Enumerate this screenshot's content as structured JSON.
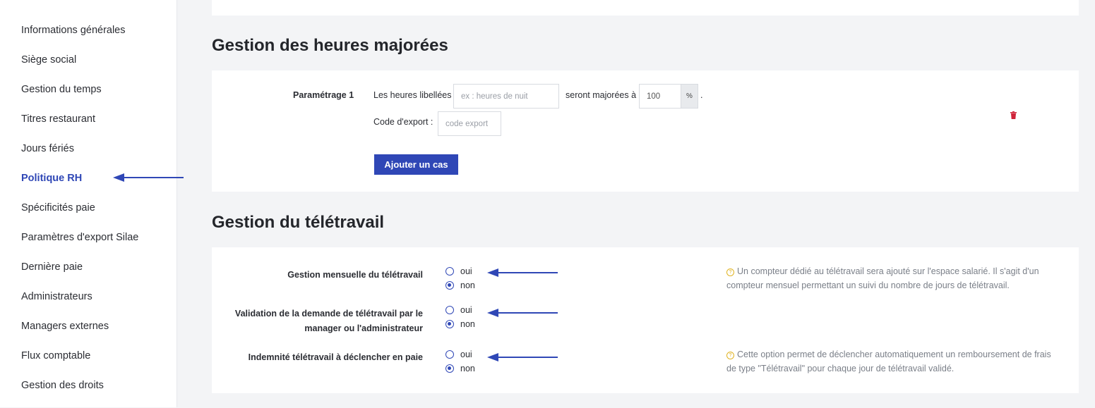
{
  "sidebar": {
    "items": [
      {
        "label": "Informations générales"
      },
      {
        "label": "Siège social"
      },
      {
        "label": "Gestion du temps"
      },
      {
        "label": "Titres restaurant"
      },
      {
        "label": "Jours fériés"
      },
      {
        "label": "Politique RH",
        "active": true
      },
      {
        "label": "Spécificités paie"
      },
      {
        "label": "Paramètres d'export Silae"
      },
      {
        "label": "Dernière paie"
      },
      {
        "label": "Administrateurs"
      },
      {
        "label": "Managers externes"
      },
      {
        "label": "Flux comptable"
      },
      {
        "label": "Gestion des droits"
      }
    ]
  },
  "heures_majorees": {
    "title": "Gestion des heures majorées",
    "setting_label": "Paramétrage 1",
    "text_before": "Les heures libellées",
    "name_placeholder": "ex : heures de nuit",
    "text_middle": "seront majorées à",
    "rate_value": "100",
    "rate_unit": "%",
    "text_end": ".",
    "export_label": "Code d'export :",
    "export_placeholder": "code export",
    "add_button": "Ajouter un cas"
  },
  "teletravail": {
    "title": "Gestion du télétravail",
    "rows": [
      {
        "label": "Gestion mensuelle du télétravail",
        "oui": "oui",
        "non": "non",
        "selected": "non",
        "help": "Un compteur dédié au télétravail sera ajouté sur l'espace salarié. Il s'agit d'un compteur mensuel permettant un suivi du nombre de jours de télétravail."
      },
      {
        "label": "Validation de la demande de télétravail par le manager ou l'administrateur",
        "oui": "oui",
        "non": "non",
        "selected": "non"
      },
      {
        "label": "Indemnité télétravail à déclencher en paie",
        "oui": "oui",
        "non": "non",
        "selected": "non",
        "help": "Cette option permet de déclencher automatiquement un remboursement de frais de type \"Télétravail\" pour chaque jour de télétravail validé."
      }
    ]
  },
  "colors": {
    "accent": "#2f47b6",
    "danger": "#d0243a",
    "help": "#e0b322"
  },
  "icons": [
    "trash-icon",
    "help-icon",
    "arrow-left-icon"
  ]
}
